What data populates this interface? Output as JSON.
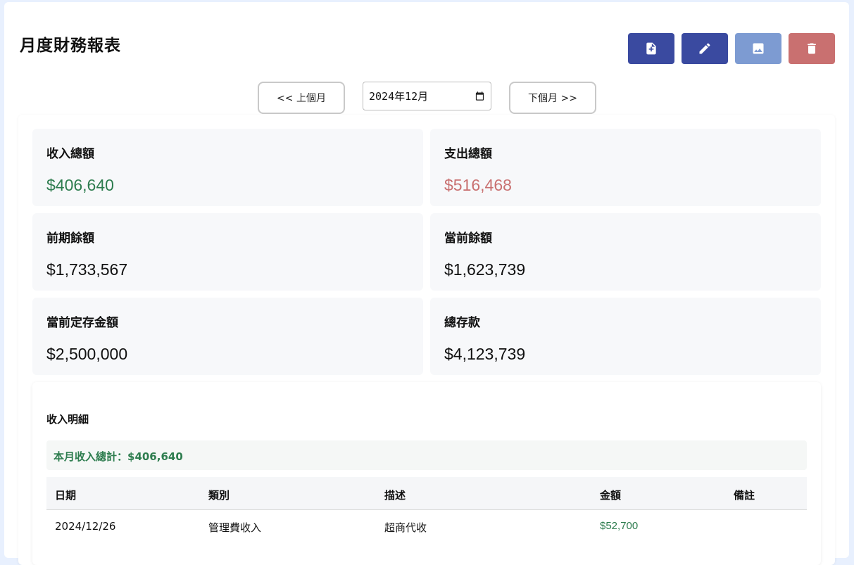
{
  "header": {
    "title": "月度財務報表"
  },
  "toolbar": {
    "buttons": [
      {
        "icon": "add-document-icon",
        "color": "#3a4aa0"
      },
      {
        "icon": "edit-pencil-icon",
        "color": "#3a4aa0"
      },
      {
        "icon": "image-icon",
        "color": "#7d9bd2"
      },
      {
        "icon": "trash-icon",
        "color": "#c97070"
      }
    ]
  },
  "month_nav": {
    "prev_label": "<< 上個月",
    "next_label": "下個月 >>",
    "current_value": "2024年12月"
  },
  "summary_cards": {
    "income_total": {
      "label": "收入總額",
      "value": "$406,640",
      "color": "#2e7d4f"
    },
    "expense_total": {
      "label": "支出總額",
      "value": "$516,468",
      "color": "#c97070"
    },
    "previous_balance": {
      "label": "前期餘額",
      "value": "$1,733,567"
    },
    "current_balance": {
      "label": "當前餘額",
      "value": "$1,623,739"
    },
    "fixed_deposit": {
      "label": "當前定存金額",
      "value": "$2,500,000"
    },
    "total_savings": {
      "label": "總存款",
      "value": "$4,123,739"
    }
  },
  "income_detail": {
    "title": "收入明細",
    "summary": "本月收入總計：$406,640",
    "columns": [
      "日期",
      "類別",
      "描述",
      "金額",
      "備註"
    ],
    "rows": [
      {
        "date": "2024/12/26",
        "category": "管理費收入",
        "description": "超商代收",
        "amount": "$52,700",
        "note": ""
      }
    ]
  }
}
